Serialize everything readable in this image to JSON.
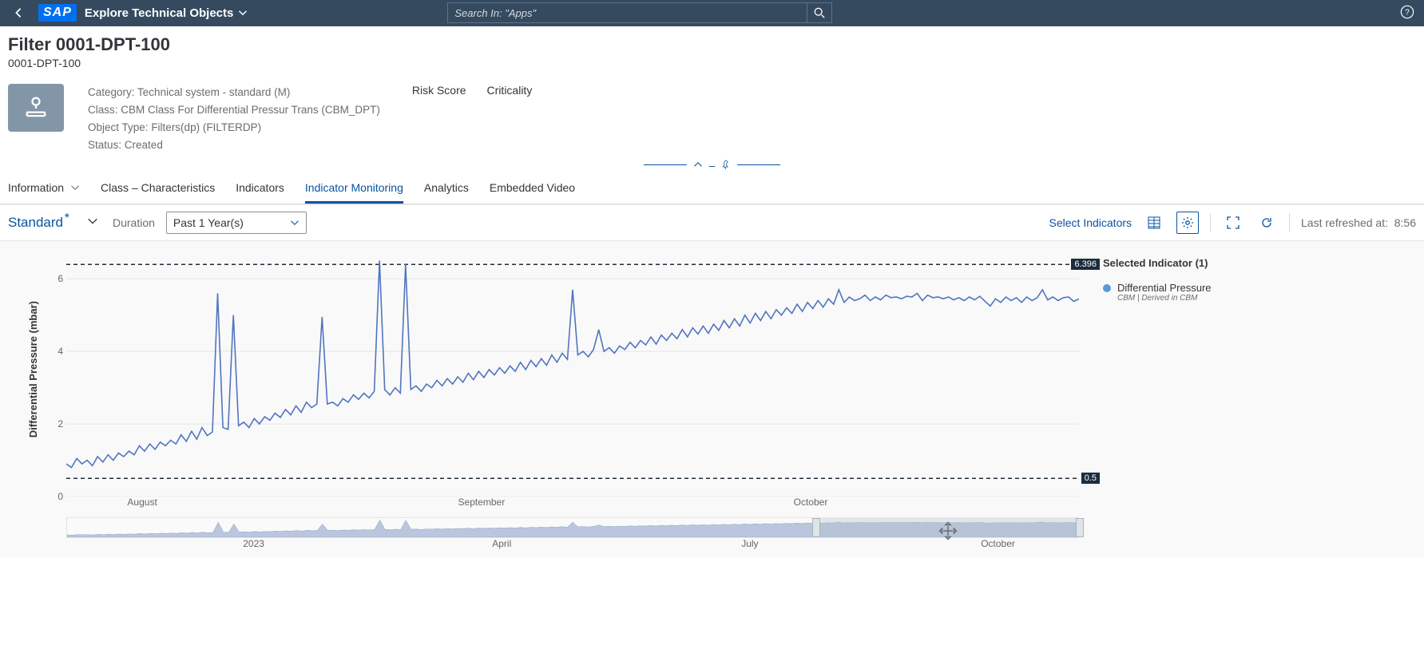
{
  "shell": {
    "app_title": "Explore Technical Objects",
    "search_placeholder": "Search In: \"Apps\""
  },
  "header": {
    "title": "Filter 0001-DPT-100",
    "subtitle": "0001-DPT-100",
    "meta": {
      "category_label": "Category:",
      "category_value": "Technical system - standard (M)",
      "class_label": "Class:",
      "class_value": "CBM Class For Differential Pressur Trans (CBM_DPT)",
      "object_type_label": "Object Type:",
      "object_type_value": "Filters(dp) (FILTERDP)",
      "status_label": "Status:",
      "status_value": "Created"
    },
    "risk_label": "Risk Score",
    "criticality_label": "Criticality"
  },
  "tabs": [
    {
      "label": "Information",
      "has_chev": true
    },
    {
      "label": "Class – Characteristics"
    },
    {
      "label": "Indicators"
    },
    {
      "label": "Indicator Monitoring",
      "active": true
    },
    {
      "label": "Analytics"
    },
    {
      "label": "Embedded Video"
    }
  ],
  "toolbar": {
    "variant": "Standard",
    "duration_label": "Duration",
    "duration_value": "Past 1 Year(s)",
    "select_indicators": "Select Indicators",
    "refreshed_label": "Last refreshed at:",
    "refreshed_time": "8:56"
  },
  "legend": {
    "title": "Selected Indicator (1)",
    "items": [
      {
        "name": "Differential Pressure",
        "sub": "CBM | Derived in CBM",
        "color": "#5899da"
      }
    ]
  },
  "chart_data": {
    "type": "line",
    "title": "",
    "xlabel": "",
    "ylabel": "Differential Pressure (mbar)",
    "ylim": [
      0,
      6.6
    ],
    "yticks": [
      0,
      2,
      4,
      6
    ],
    "thresholds": [
      {
        "value": 6.396,
        "label": "6.396"
      },
      {
        "value": 0.5,
        "label": "0.5"
      }
    ],
    "x_range": [
      "2023-07-18",
      "2023-10-28"
    ],
    "x_ticks": [
      {
        "pos": 0.075,
        "label": "August"
      },
      {
        "pos": 0.41,
        "label": "September"
      },
      {
        "pos": 0.735,
        "label": "October"
      }
    ],
    "series": [
      {
        "name": "Differential Pressure",
        "color": "#5175c0",
        "values": [
          0.9,
          0.8,
          1.05,
          0.9,
          1.0,
          0.85,
          1.1,
          0.95,
          1.15,
          1.0,
          1.2,
          1.1,
          1.25,
          1.15,
          1.4,
          1.25,
          1.45,
          1.3,
          1.5,
          1.4,
          1.55,
          1.45,
          1.7,
          1.52,
          1.8,
          1.58,
          1.9,
          1.68,
          1.78,
          5.6,
          1.9,
          1.85,
          5.0,
          1.95,
          2.05,
          1.9,
          2.15,
          2.0,
          2.2,
          2.1,
          2.3,
          2.18,
          2.4,
          2.25,
          2.5,
          2.32,
          2.6,
          2.45,
          2.55,
          4.95,
          2.55,
          2.6,
          2.5,
          2.7,
          2.6,
          2.8,
          2.68,
          2.85,
          2.72,
          2.9,
          6.5,
          2.95,
          2.8,
          3.0,
          2.85,
          6.4,
          2.95,
          3.05,
          2.9,
          3.1,
          3.0,
          3.2,
          3.05,
          3.25,
          3.1,
          3.3,
          3.15,
          3.4,
          3.22,
          3.45,
          3.28,
          3.5,
          3.35,
          3.55,
          3.4,
          3.6,
          3.45,
          3.7,
          3.5,
          3.75,
          3.58,
          3.8,
          3.62,
          3.9,
          3.7,
          3.95,
          3.78,
          5.7,
          3.9,
          4.0,
          3.85,
          4.05,
          4.6,
          4.0,
          4.1,
          3.95,
          4.15,
          4.05,
          4.25,
          4.1,
          4.3,
          4.18,
          4.4,
          4.2,
          4.45,
          4.3,
          4.5,
          4.35,
          4.6,
          4.4,
          4.65,
          4.48,
          4.7,
          4.5,
          4.75,
          4.58,
          4.85,
          4.65,
          4.9,
          4.7,
          5.0,
          4.78,
          5.05,
          4.85,
          5.1,
          4.9,
          5.15,
          5.0,
          5.2,
          5.05,
          5.3,
          5.1,
          5.35,
          5.18,
          5.4,
          5.22,
          5.45,
          5.3,
          5.7,
          5.35,
          5.5,
          5.4,
          5.45,
          5.55,
          5.4,
          5.5,
          5.42,
          5.55,
          5.48,
          5.5,
          5.45,
          5.52,
          5.5,
          5.6,
          5.4,
          5.55,
          5.48,
          5.5,
          5.45,
          5.5,
          5.42,
          5.48,
          5.4,
          5.5,
          5.42,
          5.52,
          5.38,
          5.25,
          5.45,
          5.35,
          5.5,
          5.4,
          5.48,
          5.35,
          5.5,
          5.4,
          5.48,
          5.7,
          5.42,
          5.5,
          5.4,
          5.48,
          5.5,
          5.38,
          5.45
        ]
      }
    ],
    "overview": {
      "x_ticks": [
        {
          "pos": 0.185,
          "label": "2023"
        },
        {
          "pos": 0.43,
          "label": "April"
        },
        {
          "pos": 0.675,
          "label": "July"
        },
        {
          "pos": 0.92,
          "label": "October"
        }
      ],
      "window": {
        "start": 0.74,
        "end": 1.0
      }
    }
  }
}
